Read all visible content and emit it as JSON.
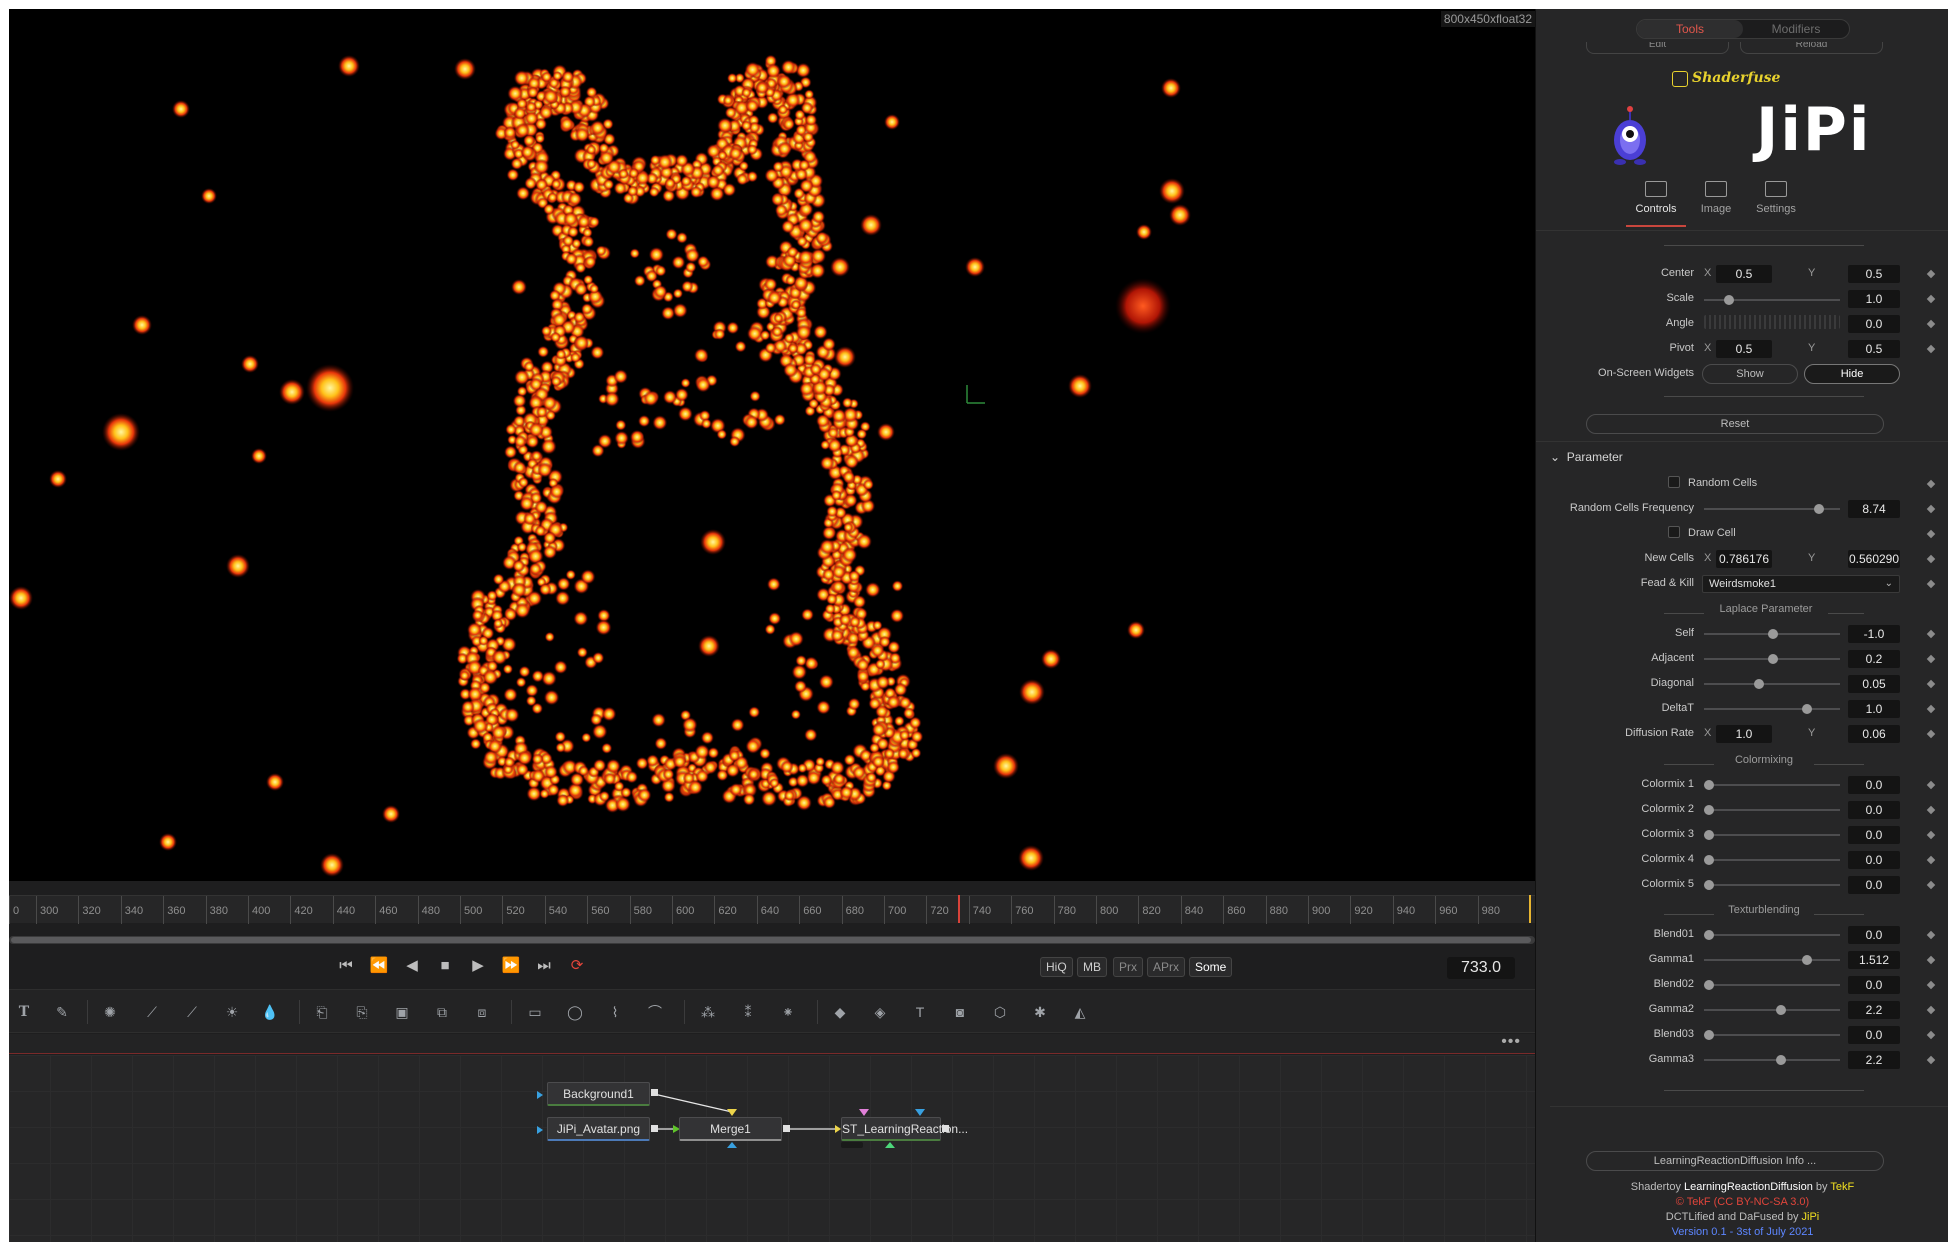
{
  "viewer": {
    "resolution_label": "800x450xfloat32"
  },
  "timeline": {
    "ticks": [
      "0",
      "300",
      "320",
      "340",
      "360",
      "380",
      "400",
      "420",
      "440",
      "460",
      "480",
      "500",
      "520",
      "540",
      "560",
      "580",
      "600",
      "620",
      "640",
      "660",
      "680",
      "700",
      "720",
      "740",
      "760",
      "780",
      "800",
      "820",
      "840",
      "860",
      "880",
      "900",
      "920",
      "940",
      "960",
      "980"
    ],
    "current_frame": "733.0"
  },
  "transport": {
    "quality_buttons": [
      "HiQ",
      "MB",
      "Prx",
      "APrx",
      "Some"
    ]
  },
  "flow": {
    "nodes": {
      "background": "Background1",
      "loader": "JiPi_Avatar.png",
      "merge": "Merge1",
      "shader": "ST_LearningReaction..."
    }
  },
  "inspector": {
    "tabs": [
      "Tools",
      "Modifiers"
    ],
    "header_buttons": [
      "Edit",
      "Reload"
    ],
    "brand": "Shaderfuse",
    "logo_text": "JiPi",
    "subtabs": [
      "Controls",
      "Image",
      "Settings"
    ],
    "transform": {
      "center_label": "Center",
      "center_x": "0.5",
      "center_y": "0.5",
      "scale_label": "Scale",
      "scale": "1.0",
      "angle_label": "Angle",
      "angle": "0.0",
      "pivot_label": "Pivot",
      "pivot_x": "0.5",
      "pivot_y": "0.5",
      "widgets_label": "On-Screen Widgets",
      "show": "Show",
      "hide": "Hide",
      "reset": "Reset",
      "x": "X",
      "y": "Y"
    },
    "parameter": {
      "section": "Parameter",
      "random_cells": "Random Cells",
      "random_cells_frequency_label": "Random Cells Frequency",
      "random_cells_frequency": "8.74",
      "draw_cell": "Draw Cell",
      "new_cells_label": "New Cells",
      "new_cells_x": "0.786176",
      "new_cells_y": "0.560290",
      "feed_kill_label": "Fead & Kill",
      "feed_kill_value": "Weirdsmoke1",
      "laplace_header": "Laplace Parameter",
      "self_label": "Self",
      "self": "-1.0",
      "adjacent_label": "Adjacent",
      "adjacent": "0.2",
      "diagonal_label": "Diagonal",
      "diagonal": "0.05",
      "deltat_label": "DeltaT",
      "deltat": "1.0",
      "diffusion_label": "Diffusion Rate",
      "diffusion_x": "1.0",
      "diffusion_y": "0.06",
      "colormixing_header": "Colormixing",
      "colormix": [
        {
          "label": "Colormix 1",
          "value": "0.0"
        },
        {
          "label": "Colormix 2",
          "value": "0.0"
        },
        {
          "label": "Colormix 3",
          "value": "0.0"
        },
        {
          "label": "Colormix 4",
          "value": "0.0"
        },
        {
          "label": "Colormix 5",
          "value": "0.0"
        }
      ],
      "texturblending_header": "Texturblending",
      "blend": [
        {
          "label": "Blend01",
          "value": "0.0"
        },
        {
          "label": "Gamma1",
          "value": "1.512"
        },
        {
          "label": "Blend02",
          "value": "0.0"
        },
        {
          "label": "Gamma2",
          "value": "2.2"
        },
        {
          "label": "Blend03",
          "value": "0.0"
        },
        {
          "label": "Gamma3",
          "value": "2.2"
        }
      ]
    },
    "footer": {
      "info_button": "LearningReactionDiffusion Info ...",
      "line1_a": "Shadertoy ",
      "line1_b": "LearningReactionDiffusion",
      "line1_c": " by ",
      "line1_d": "TekF",
      "line2": "© TekF (CC BY-NC-SA 3.0)",
      "line3_a": "DCTLified and DaFused by ",
      "line3_b": "JiPi",
      "line4": "Version 0.1 - 3st of July 2021"
    }
  },
  "colors": {
    "accent_red": "#e2574c",
    "glow_yellow": "#ffd23a",
    "glow_red": "#e0250e",
    "brand_yellow": "#e8d22e"
  }
}
